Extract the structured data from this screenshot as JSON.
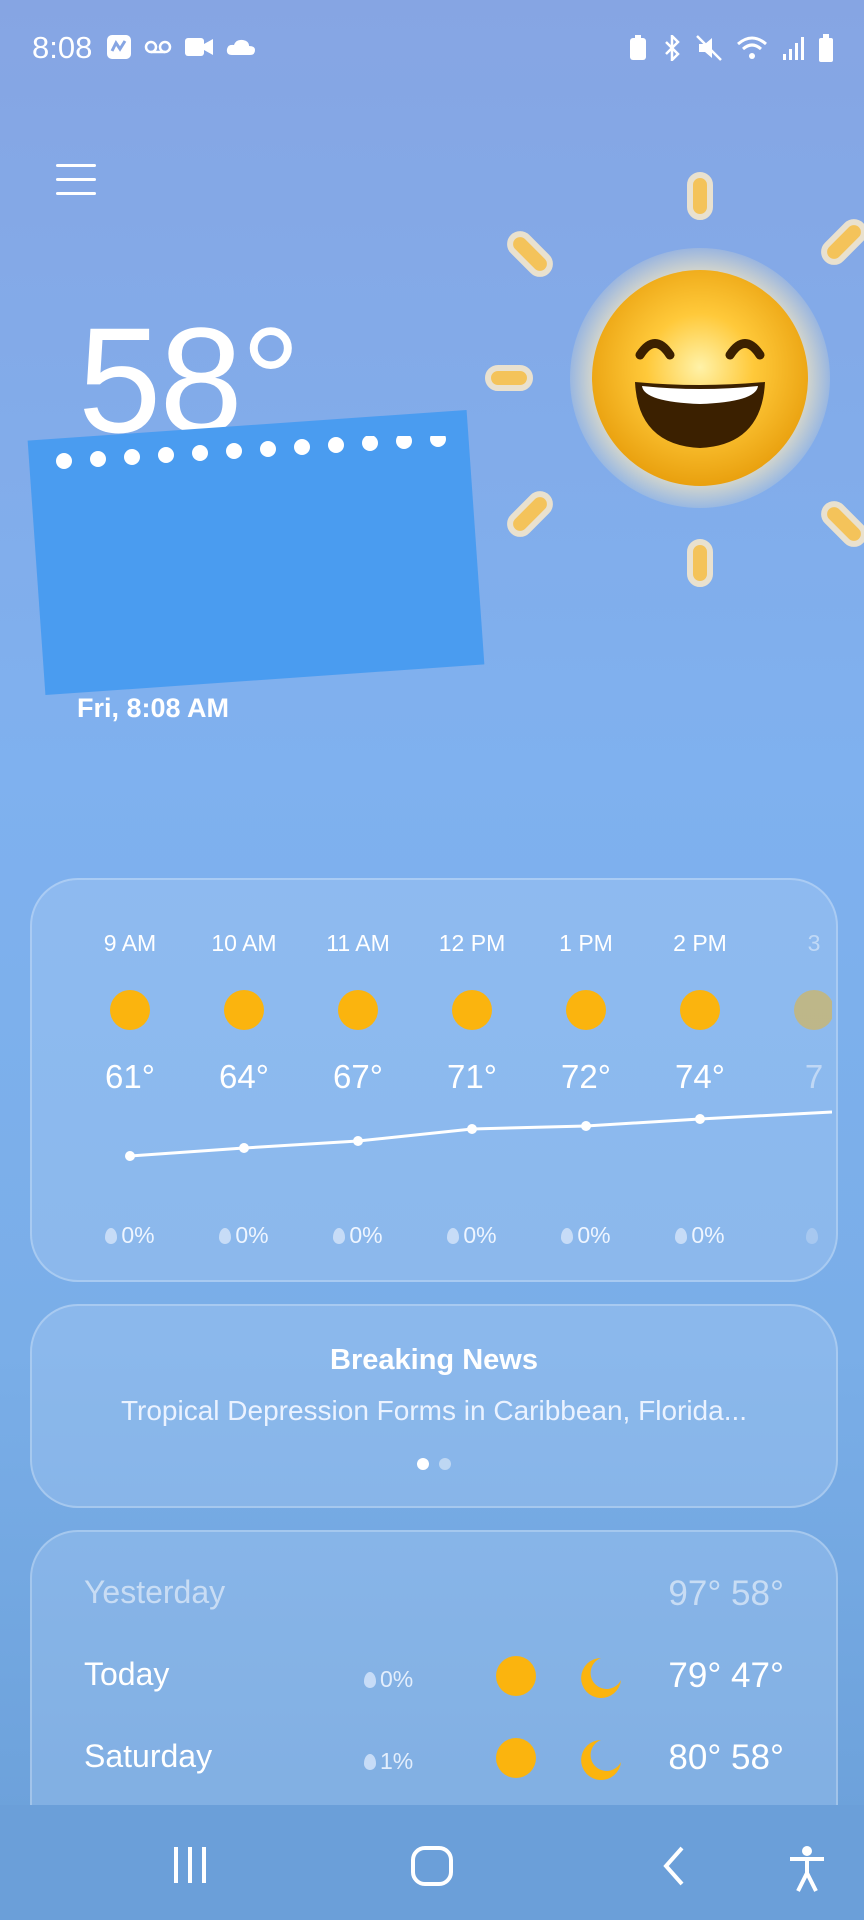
{
  "status_bar": {
    "time": "8:08"
  },
  "current": {
    "temperature": "58°",
    "datetime": "Fri, 8:08 AM"
  },
  "hourly": [
    {
      "hour": "9 AM",
      "temp": "61°",
      "precip": "0%"
    },
    {
      "hour": "10 AM",
      "temp": "64°",
      "precip": "0%"
    },
    {
      "hour": "11 AM",
      "temp": "67°",
      "precip": "0%"
    },
    {
      "hour": "12 PM",
      "temp": "71°",
      "precip": "0%"
    },
    {
      "hour": "1 PM",
      "temp": "72°",
      "precip": "0%"
    },
    {
      "hour": "2 PM",
      "temp": "74°",
      "precip": "0%"
    },
    {
      "hour": "3",
      "temp": "7",
      "precip": ""
    }
  ],
  "news": {
    "heading": "Breaking News",
    "headline": "Tropical Depression Forms in Caribbean, Florida..."
  },
  "daily": [
    {
      "day": "Yesterday",
      "precip": "",
      "temps": "97° 58°"
    },
    {
      "day": "Today",
      "precip": "0%",
      "temps": "79° 47°"
    },
    {
      "day": "Saturday",
      "precip": "1%",
      "temps": "80° 58°"
    }
  ],
  "colors": {
    "sun": "#fbb40e",
    "sticker": "#4a9cf0",
    "accent": "#ffffff"
  }
}
